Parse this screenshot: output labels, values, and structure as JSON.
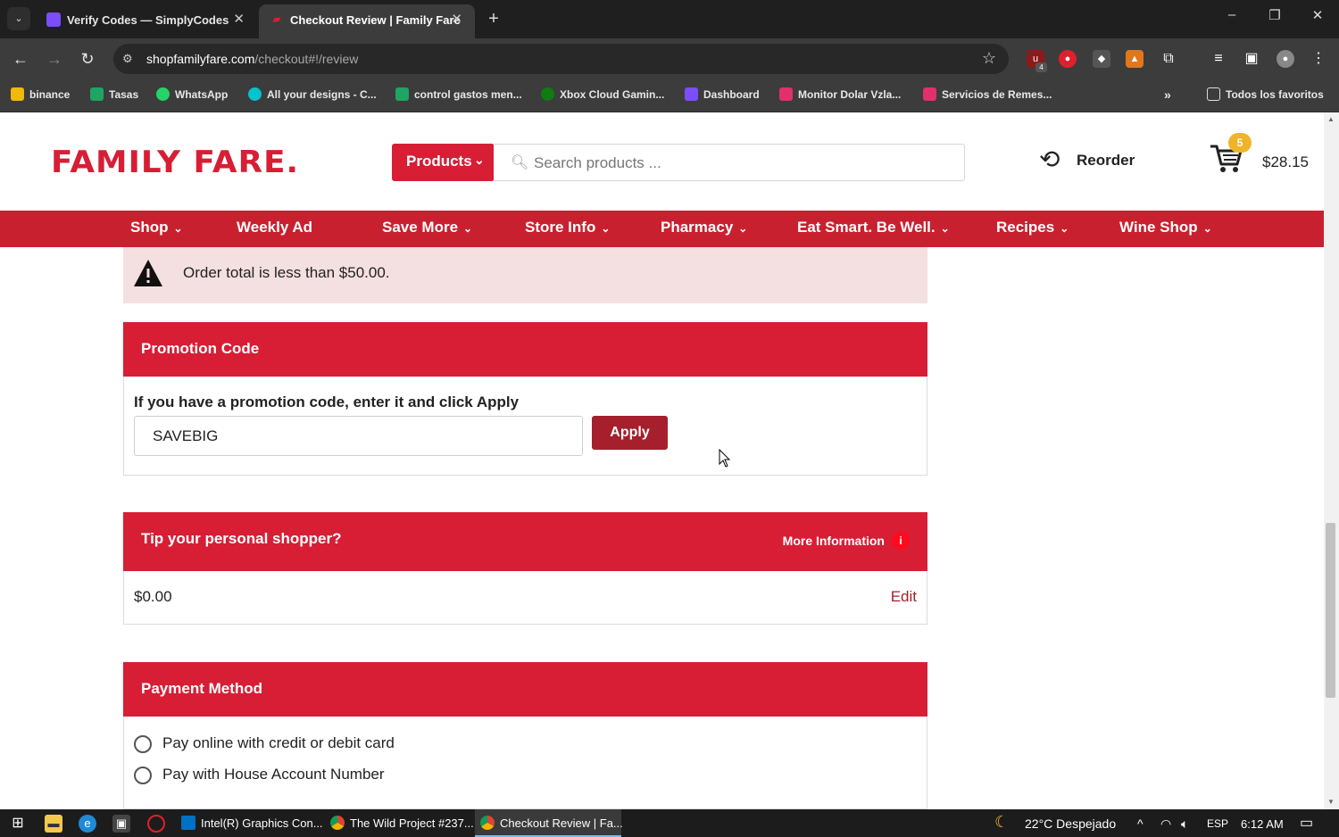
{
  "browser": {
    "tabs": [
      {
        "title": "Verify Codes — SimplyCodes",
        "active": false,
        "favicon_color": "#7c4dff"
      },
      {
        "title": "Checkout Review | Family Fare",
        "active": true,
        "favicon_color": "#d71e35"
      }
    ],
    "url_domain": "shopfamilyfare.com",
    "url_path": "/checkout#!/review",
    "bookmarks": [
      {
        "label": "binance",
        "icon_color": "#f0b90b"
      },
      {
        "label": "Tasas",
        "icon_color": "#1fa463"
      },
      {
        "label": "WhatsApp",
        "icon_color": "#25d366"
      },
      {
        "label": "All your designs - C...",
        "icon_color": "#00c4cc"
      },
      {
        "label": "control gastos men...",
        "icon_color": "#1fa463"
      },
      {
        "label": "Xbox Cloud Gamin...",
        "icon_color": "#107c10"
      },
      {
        "label": "Dashboard",
        "icon_color": "#7c4dff"
      },
      {
        "label": "Monitor Dolar Vzla...",
        "icon_color": "#e1306c"
      },
      {
        "label": "Servicios de Remes...",
        "icon_color": "#e1306c"
      }
    ],
    "all_bookmarks_label": "Todos los favoritos",
    "extension_badge": "4"
  },
  "site": {
    "logo": "FAMILY FARE.",
    "products_label": "Products",
    "search_placeholder": "Search products ...",
    "reorder_label": "Reorder",
    "cart_count": "5",
    "cart_total": "$28.15",
    "nav": [
      {
        "label": "Shop",
        "dropdown": true
      },
      {
        "label": "Weekly Ad",
        "dropdown": false
      },
      {
        "label": "Save More",
        "dropdown": true
      },
      {
        "label": "Store Info",
        "dropdown": true
      },
      {
        "label": "Pharmacy",
        "dropdown": true
      },
      {
        "label": "Eat Smart. Be Well.",
        "dropdown": true
      },
      {
        "label": "Recipes",
        "dropdown": true
      },
      {
        "label": "Wine Shop",
        "dropdown": true
      }
    ],
    "brand_color": "#d71e35"
  },
  "checkout": {
    "alert_text": "Order total is less than $50.00.",
    "promo": {
      "title": "Promotion Code",
      "instruction": "If you have a promotion code, enter it and click Apply",
      "code_value": "SAVEBIG",
      "apply_label": "Apply"
    },
    "tip": {
      "title": "Tip your personal shopper?",
      "more_info_label": "More Information",
      "info_icon": "i",
      "amount": "$0.00",
      "edit_label": "Edit"
    },
    "payment": {
      "title": "Payment Method",
      "options": [
        {
          "label": "Pay online with credit or debit card",
          "selected": false
        },
        {
          "label": "Pay with House Account Number",
          "selected": false
        }
      ]
    }
  },
  "taskbar": {
    "apps": [
      {
        "label": "Intel(R) Graphics Con...",
        "active": false
      },
      {
        "label": "The Wild Project #237...",
        "active": false
      },
      {
        "label": "Checkout Review | Fa...",
        "active": true
      }
    ],
    "weather": "22°C  Despejado",
    "language": "ESP",
    "time": "6:12 AM"
  }
}
